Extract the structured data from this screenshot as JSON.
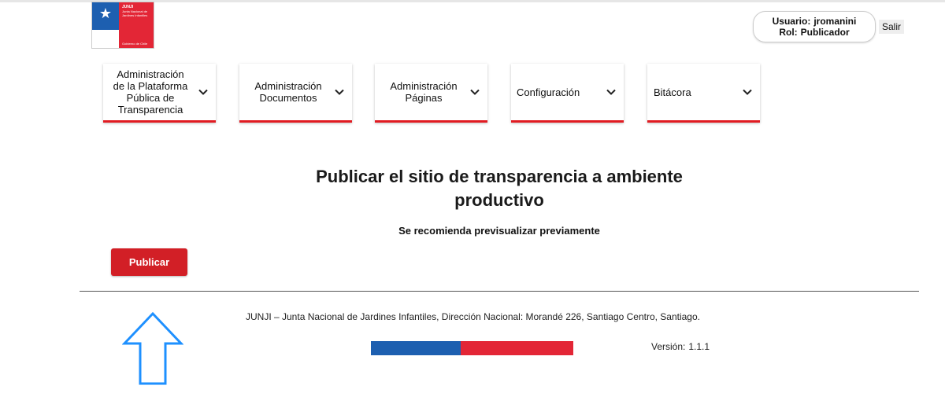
{
  "header": {
    "logo": {
      "line1": "JUNJI",
      "line2": "Junta Nacional de Jardines Infantiles",
      "footer": "Gobierno de Chile"
    },
    "user": {
      "user_label": "Usuario:",
      "username": "jromanini",
      "role_label": "Rol:",
      "role": "Publicador"
    },
    "logout_label": "Salir"
  },
  "nav": {
    "items": [
      {
        "label": "Administración de la Plataforma Pública de Transparencia"
      },
      {
        "label": "Administración Documentos"
      },
      {
        "label": "Administración Páginas"
      },
      {
        "label": "Configuración"
      },
      {
        "label": "Bitácora"
      }
    ]
  },
  "main": {
    "title": "Publicar el sitio de transparencia a ambiente productivo",
    "subtitle": "Se recomienda previsualizar previamente",
    "publish_label": "Publicar"
  },
  "footer": {
    "address": "JUNJI – Junta Nacional de Jardines Infantiles, Dirección Nacional: Morandé 226, Santiago Centro, Santiago.",
    "version_label": "Versión:",
    "version": "1.1.1"
  },
  "colors": {
    "accent_red": "#d21f26",
    "flag_blue": "#1d5fb0",
    "flag_red": "#e32636",
    "annotation_arrow": "#1e90ff"
  },
  "icons": {
    "nav_chevron": "chevron-down-icon",
    "annotation": "arrow-up-icon",
    "logo_star": "star-icon"
  }
}
